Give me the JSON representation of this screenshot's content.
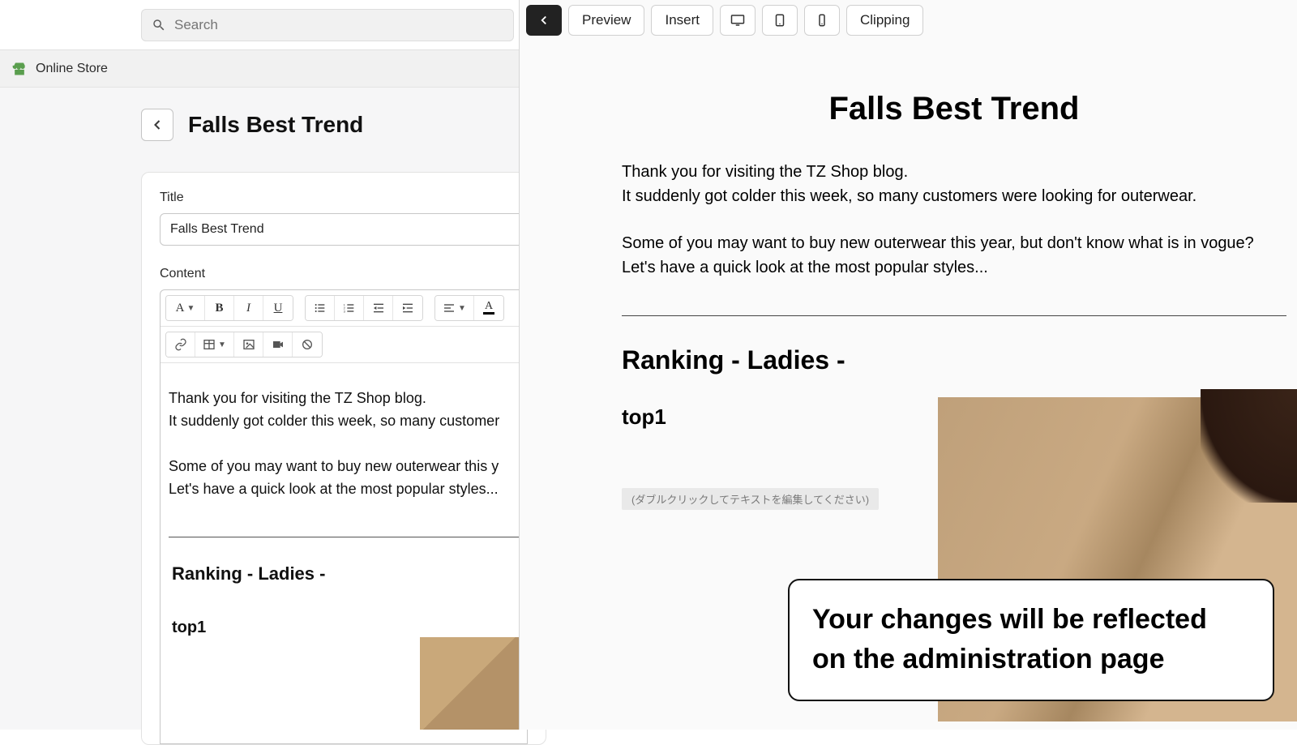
{
  "search": {
    "placeholder": "Search"
  },
  "nav": {
    "onlineStore": "Online Store"
  },
  "page": {
    "title": "Falls Best Trend"
  },
  "form": {
    "titleLabel": "Title",
    "titleValue": "Falls Best Trend",
    "contentLabel": "Content"
  },
  "content": {
    "p1": "Thank you for visiting the TZ Shop blog.",
    "p2": "It suddenly got colder this week, so many customers were looking for outerwear.",
    "p2short": "It suddenly got colder this week, so many customer",
    "p3": "Some of you may want to buy new outerwear this year, but don't know what is in vogue?",
    "p3short": "Some of you may want to buy new outerwear this y",
    "p4": "Let's have a quick look at the most popular styles...",
    "rankingHeading": "Ranking - Ladies -",
    "top1": "top1"
  },
  "previewToolbar": {
    "preview": "Preview",
    "insert": "Insert",
    "clipping": "Clipping"
  },
  "placeholder": "(ダブルクリックしてテキストを編集してください)",
  "callout": {
    "line1": "Your changes will be reflected",
    "line2": "on the administration page"
  }
}
